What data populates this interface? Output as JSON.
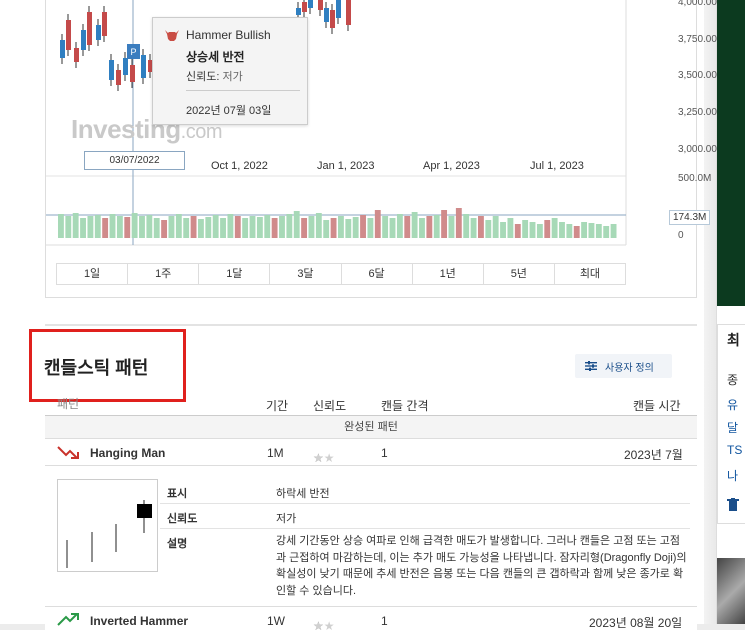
{
  "chart": {
    "y_axis_labels": [
      "4,000.00",
      "3,750.00",
      "3,500.00",
      "3,250.00",
      "3,000.00"
    ],
    "x_axis_labels": [
      "Oct 1, 2022",
      "Jan 1, 2023",
      "Apr 1, 2023",
      "Jul 1, 2023"
    ],
    "volume_axis_labels": [
      "500.0M",
      "0"
    ],
    "volume_current": "174.3M",
    "crosshair_date": "03/07/2022",
    "watermark": "Investing",
    "watermark_suffix": ".com",
    "pattern_marker": "P",
    "colors": {
      "up": "#5fb883",
      "down": "#c44a4a",
      "up_volume": "#a7d9b7",
      "down_volume": "#d08b8b",
      "crosshair": "#8aa6c1"
    }
  },
  "tooltip": {
    "pattern_name": "Hammer Bullish",
    "signal": "상승세 반전",
    "reliability_label": "신뢰도:",
    "reliability_value": "저가",
    "date": "2022년 07월 03일",
    "icon": "bull-icon"
  },
  "timeframes": [
    "1일",
    "1주",
    "1달",
    "3달",
    "6달",
    "1년",
    "5년",
    "최대"
  ],
  "candlestick": {
    "title": "캔들스틱 패턴",
    "custom_button": "사용자 정의",
    "columns": {
      "pattern": "패턴",
      "period": "기간",
      "reliability": "신뢰도",
      "interval": "캔들 간격",
      "time": "캔들 시간"
    },
    "completed_label": "완성된 패턴",
    "rows": [
      {
        "name": "Hanging Man",
        "period": "1M",
        "stars": 1,
        "interval": "1",
        "time": "2023년 7월",
        "icon": "bearish-arrow-icon"
      },
      {
        "name": "Inverted Hammer",
        "period": "1W",
        "stars": 1,
        "interval": "1",
        "time": "2023년 08월 20일",
        "icon": "bullish-arrow-icon"
      }
    ],
    "detail": {
      "signal_label": "표시",
      "signal_value": "하락세 반전",
      "reliability_label": "신뢰도",
      "reliability_value": "저가",
      "description_label": "설명",
      "description": "강세 기간동안 상승 여파로 인해 급격한 매도가 발생합니다. 그러나 캔들은 고점 또는 고점과 근접하여 마감하는데, 이는 추가 매도 가능성을 나타냅니다. 잠자리형(Dragonfly Doji)의 확실성이 낮기 때문에 추세 반전은 음봉 또는 다음 캔들의 큰 갭하락과 함께 낮은 종가로 확인할 수 있습니다."
    }
  },
  "right_panel": {
    "title": "최",
    "items": [
      "종",
      "유",
      "달",
      "TS",
      "나"
    ]
  }
}
